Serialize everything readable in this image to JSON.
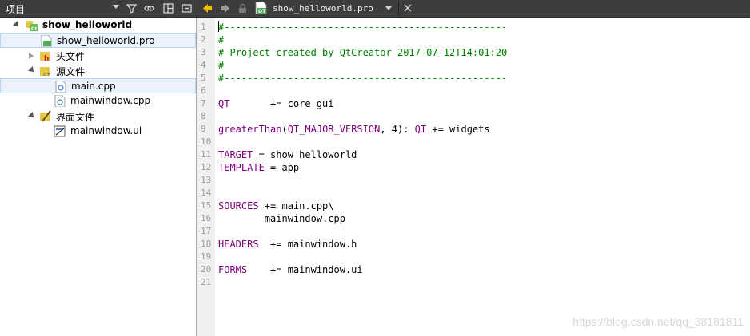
{
  "toolbar": {
    "panel_title": "项目",
    "file_tab_name": "show_helloworld.pro"
  },
  "tree": {
    "project": "show_helloworld",
    "pro_file": "show_helloworld.pro",
    "headers": "头文件",
    "sources": "源文件",
    "main_cpp": "main.cpp",
    "mainwindow_cpp": "mainwindow.cpp",
    "forms": "界面文件",
    "mainwindow_ui": "mainwindow.ui"
  },
  "editor": {
    "line_numbers": [
      "1",
      "2",
      "3",
      "4",
      "5",
      "6",
      "7",
      "8",
      "9",
      "10",
      "11",
      "12",
      "13",
      "14",
      "15",
      "16",
      "17",
      "18",
      "19",
      "20",
      "21"
    ],
    "lines": [
      [
        {
          "t": "#-------------------------------------------------",
          "c": "cm"
        }
      ],
      [
        {
          "t": "#",
          "c": "cm"
        }
      ],
      [
        {
          "t": "# Project created by QtCreator 2017-07-12T14:01:20",
          "c": "cm"
        }
      ],
      [
        {
          "t": "#",
          "c": "cm"
        }
      ],
      [
        {
          "t": "#-------------------------------------------------",
          "c": "cm"
        }
      ],
      [],
      [
        {
          "t": "QT",
          "c": "kw"
        },
        {
          "t": "       += core gui",
          "c": "tx"
        }
      ],
      [],
      [
        {
          "t": "greaterThan",
          "c": "kw"
        },
        {
          "t": "(",
          "c": "tx"
        },
        {
          "t": "QT_MAJOR_VERSION",
          "c": "kw"
        },
        {
          "t": ", 4): ",
          "c": "tx"
        },
        {
          "t": "QT",
          "c": "kw"
        },
        {
          "t": " += widgets",
          "c": "tx"
        }
      ],
      [],
      [
        {
          "t": "TARGET",
          "c": "kw"
        },
        {
          "t": " = show_helloworld",
          "c": "tx"
        }
      ],
      [
        {
          "t": "TEMPLATE",
          "c": "kw"
        },
        {
          "t": " = app",
          "c": "tx"
        }
      ],
      [],
      [],
      [
        {
          "t": "SOURCES",
          "c": "kw"
        },
        {
          "t": " += main.cpp\\",
          "c": "tx"
        }
      ],
      [
        {
          "t": "        mainwindow.cpp",
          "c": "tx"
        }
      ],
      [],
      [
        {
          "t": "HEADERS",
          "c": "kw"
        },
        {
          "t": "  += mainwindow.h",
          "c": "tx"
        }
      ],
      [],
      [
        {
          "t": "FORMS",
          "c": "kw"
        },
        {
          "t": "    += mainwindow.ui",
          "c": "tx"
        }
      ],
      []
    ]
  },
  "watermark": "https://blog.csdn.net/qq_38181811",
  "colors": {
    "comment": "#008000",
    "keyword": "#800080",
    "toolbar_bg": "#3d3d3d"
  }
}
